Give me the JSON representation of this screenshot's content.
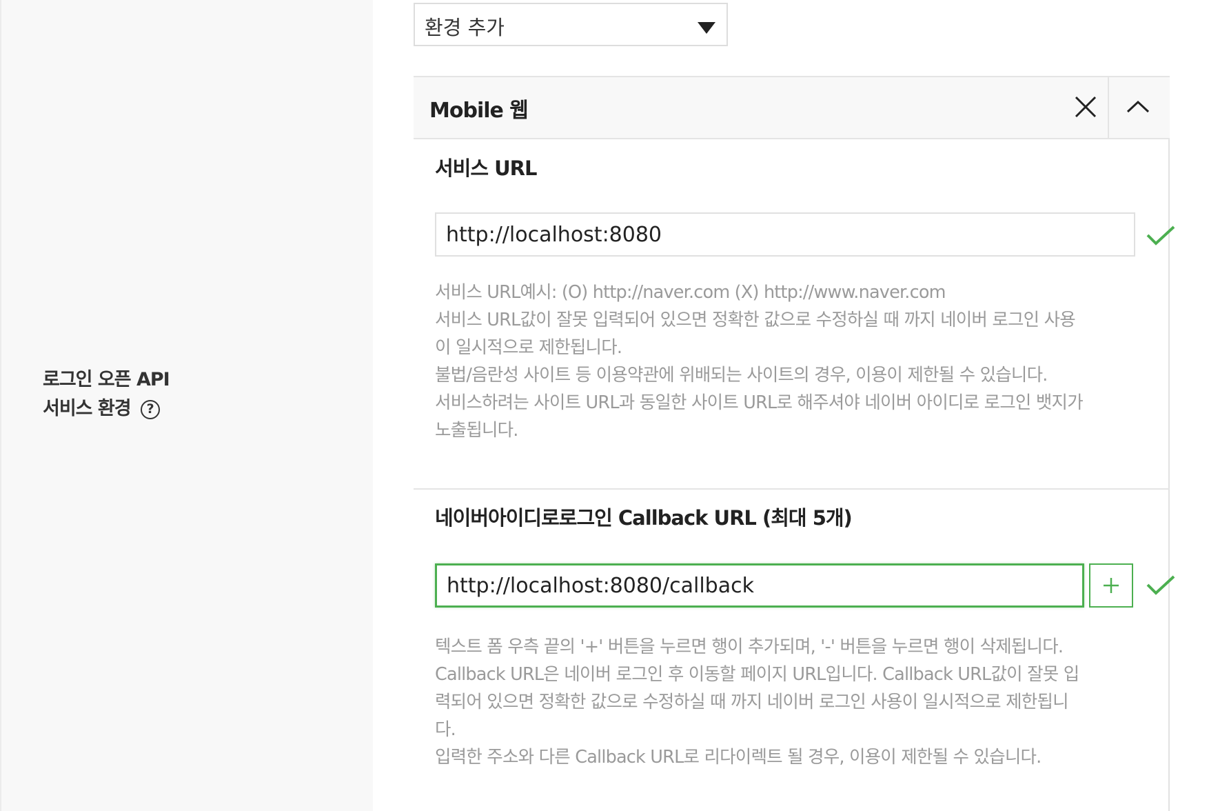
{
  "section": {
    "label_line1": "로그인 오픈 API",
    "label_line2": "서비스 환경",
    "help_icon_glyph": "?"
  },
  "env_select": {
    "value": "환경 추가"
  },
  "env_panel": {
    "title": "Mobile 웹",
    "service_url": {
      "title": "서비스 URL",
      "value": "http://localhost:8080",
      "help_lines": [
        "서비스 URL예시: (O) http://naver.com (X) http://www.naver.com",
        "서비스 URL값이 잘못 입력되어 있으면 정확한 값으로 수정하실 때 까지 네이버 로그인 사용",
        "이 일시적으로 제한됩니다.",
        "불법/음란성 사이트 등 이용약관에 위배되는 사이트의 경우, 이용이 제한될 수 있습니다.",
        "서비스하려는 사이트 URL과 동일한 사이트 URL로 해주셔야 네이버 아이디로 로그인 뱃지가",
        "노출됩니다."
      ]
    },
    "callback_url": {
      "title": "네이버아이디로로그인 Callback URL (최대 5개)",
      "value": "http://localhost:8080/callback",
      "help_lines": [
        "텍스트 폼 우측 끝의 '+' 버튼을 누르면 행이 추가되며, '-' 버튼을 누르면 행이 삭제됩니다.",
        "Callback URL은 네이버 로그인 후 이동할 페이지 URL입니다. Callback URL값이 잘못 입",
        "력되어 있으면 정확한 값으로 수정하실 때 까지 네이버 로그인 사용이 일시적으로 제한됩니",
        "다.",
        "입력한 주소와 다른 Callback URL로 리다이렉트 될 경우, 이용이 제한될 수 있습니다."
      ]
    }
  },
  "colors": {
    "accent_green": "#4caf50",
    "help_text_gray": "#9a9a9a",
    "panel_bg": "#f8f8f8"
  },
  "icons": [
    "help-circle-icon",
    "dropdown-arrow-icon",
    "close-icon",
    "chevron-up-icon",
    "check-icon",
    "plus-icon"
  ]
}
